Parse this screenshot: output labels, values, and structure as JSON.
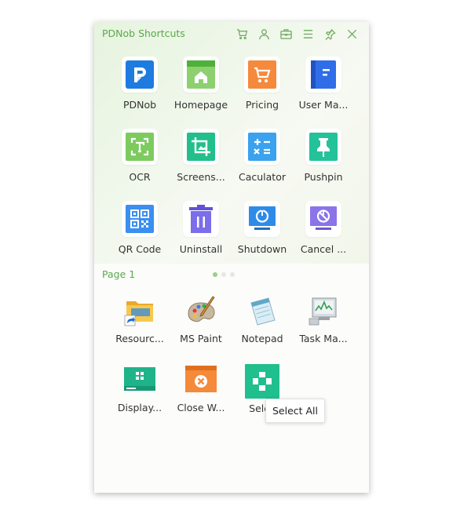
{
  "window": {
    "title": "PDNob Shortcuts"
  },
  "toolbar": {
    "icons": [
      "cart-icon",
      "user-icon",
      "toolbox-icon",
      "menu-icon",
      "pin-icon",
      "close-icon"
    ]
  },
  "shortcuts": [
    {
      "label": "PDNob",
      "icon": "pdnob-logo-icon",
      "color": "#1e7bdf"
    },
    {
      "label": "Homepage",
      "icon": "homepage-icon",
      "color": "#8dd06f"
    },
    {
      "label": "Pricing",
      "icon": "cart-icon",
      "color": "#f58a3c"
    },
    {
      "label": "User Ma...",
      "icon": "user-manual-icon",
      "color": "#2f6ee8"
    },
    {
      "label": "OCR",
      "icon": "ocr-icon",
      "color": "#7dcb5f"
    },
    {
      "label": "Screens...",
      "icon": "screenshot-icon",
      "color": "#22bf8b"
    },
    {
      "label": "Caculator",
      "icon": "calculator-icon",
      "color": "#3aa2ee"
    },
    {
      "label": "Pushpin",
      "icon": "pushpin-icon",
      "color": "#24c29a"
    },
    {
      "label": "QR Code",
      "icon": "qr-code-icon",
      "color": "#3a8ff0"
    },
    {
      "label": "Uninstall",
      "icon": "trash-icon",
      "color": "#7b6ee8"
    },
    {
      "label": "Shutdown",
      "icon": "shutdown-icon",
      "color": "#2f8be8"
    },
    {
      "label": "Cancel ...",
      "icon": "cancel-shutdown-icon",
      "color": "#8a74e8"
    }
  ],
  "pager": {
    "label": "Page 1",
    "pages": 3,
    "current": 1
  },
  "apps": [
    {
      "label": "Resourc...",
      "icon": "folder-shortcut-icon"
    },
    {
      "label": "MS Paint",
      "icon": "paint-palette-icon"
    },
    {
      "label": "Notepad",
      "icon": "notepad-icon"
    },
    {
      "label": "Task Ma...",
      "icon": "task-manager-icon"
    },
    {
      "label": "Display...",
      "icon": "display-icon"
    },
    {
      "label": "Close W...",
      "icon": "close-window-icon"
    },
    {
      "label": "Selec",
      "icon": "select-all-icon"
    }
  ],
  "tooltip": {
    "text": "Select All"
  }
}
